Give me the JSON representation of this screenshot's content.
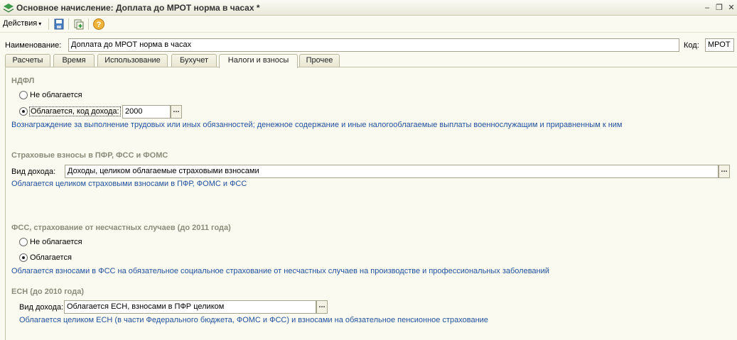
{
  "window": {
    "title": "Основное начисление: Доплата до МРОТ норма в часах *",
    "minimize": "–",
    "restore": "❐",
    "close": "✕"
  },
  "toolbar": {
    "actions_label": "Действия",
    "actions_arrow": "▾",
    "icons": [
      "save-close-icon",
      "copy-icon",
      "help-icon"
    ]
  },
  "header": {
    "name_label": "Наименование:",
    "name_value": "Доплата до МРОТ норма в часах",
    "code_label": "Код:",
    "code_value": "МРОТ"
  },
  "tabs": [
    {
      "label": "Расчеты"
    },
    {
      "label": "Время"
    },
    {
      "label": "Использование"
    },
    {
      "label": "Бухучет"
    },
    {
      "label": "Налоги и взносы"
    },
    {
      "label": "Прочее"
    }
  ],
  "active_tab": "Налоги и взносы",
  "ndfl": {
    "title": "НДФЛ",
    "option_not_taxed": "Не облагается",
    "option_taxed": "Облагается, код дохода:",
    "income_code": "2000",
    "note": "Вознаграждение за выполнение трудовых или иных обязанностей; денежное содержание и иные налогооблагаемые выплаты военнослужащим и приравненным к ним"
  },
  "insurance": {
    "title": "Страховые взносы в ПФР, ФСС и ФОМС",
    "income_type_label": "Вид дохода:",
    "income_type_value": "Доходы, целиком облагаемые страховыми взносами",
    "note": "Облагается целиком страховыми взносами в ПФР, ФОМС и ФСС"
  },
  "fss_accident": {
    "title": "ФСС, страхование от несчастных случаев (до 2011 года)",
    "option_not_taxed": "Не облагается",
    "option_taxed": "Облагается",
    "note": "Облагается взносами в ФСС на обязательное социальное страхование от несчастных случаев на производстве и профессиональных заболеваний"
  },
  "esn": {
    "title": "ЕСН (до 2010 года)",
    "income_type_label": "Вид дохода:",
    "income_type_value": "Облагается ЕСН, взносами в ПФР целиком",
    "note": "Облагается целиком ЕСН (в части Федерального бюджета, ФОМС и ФСС) и взносами на обязательное пенсионное страхование"
  },
  "ellipsis": "..."
}
